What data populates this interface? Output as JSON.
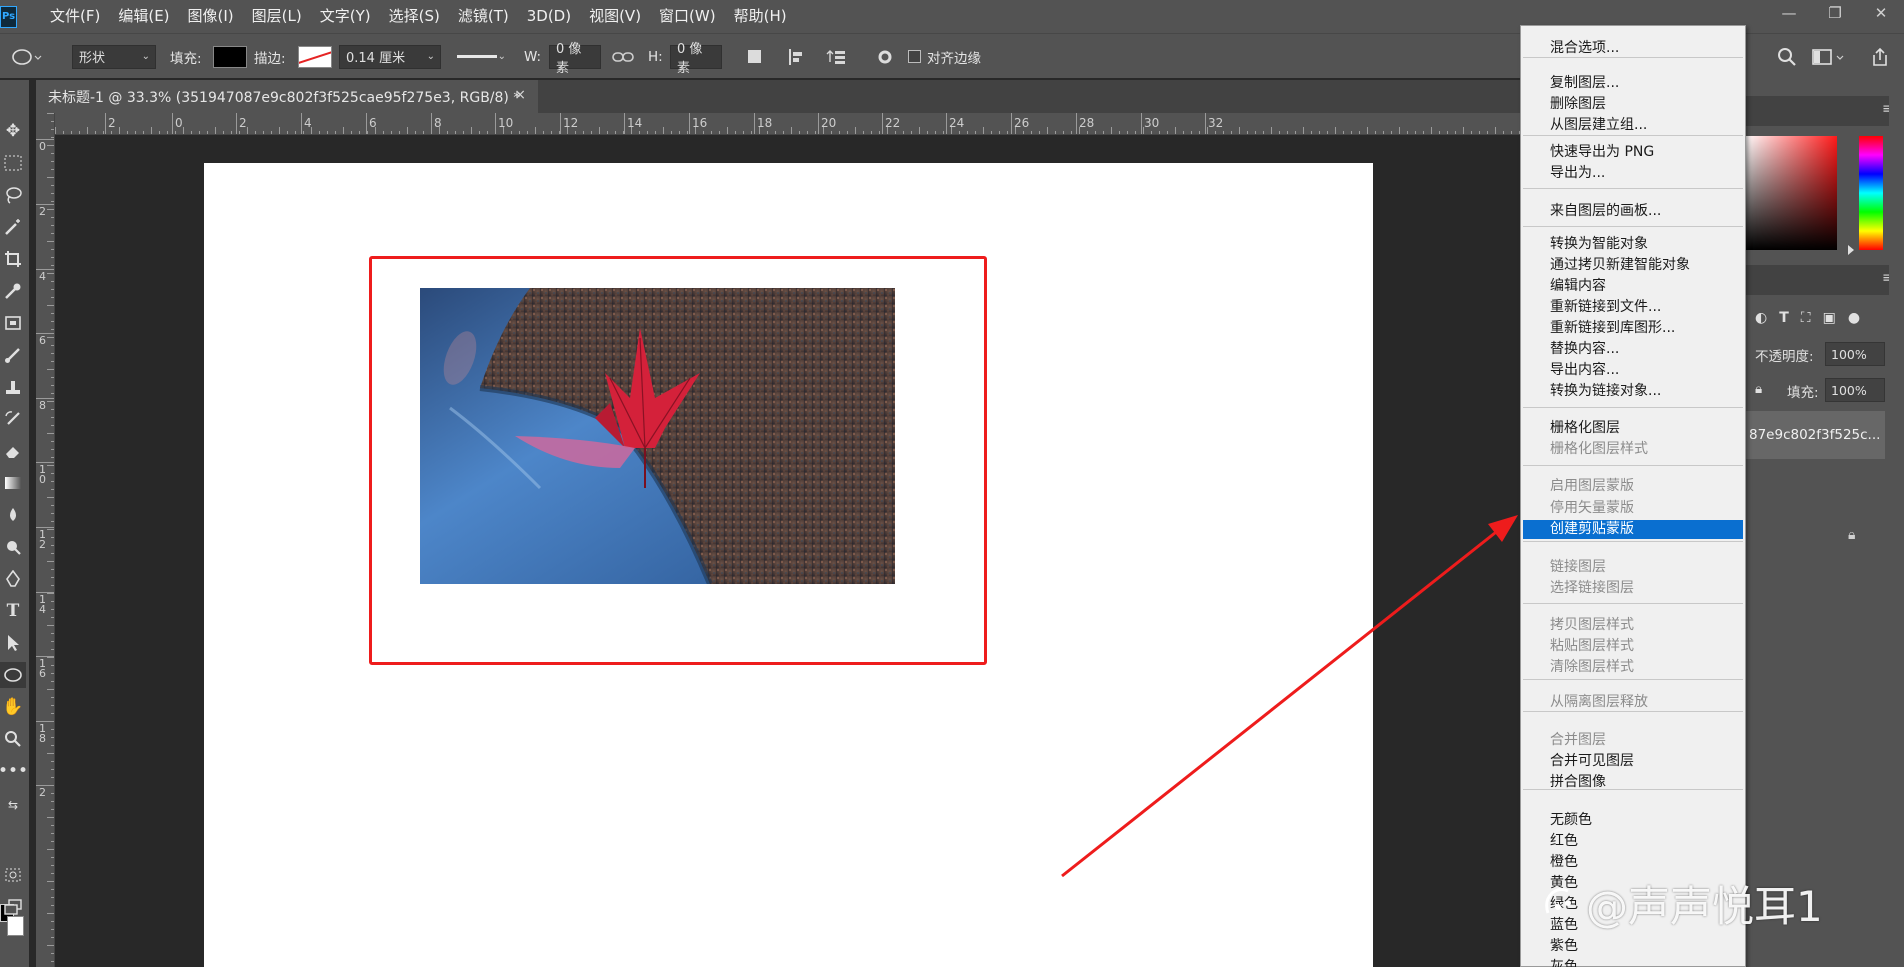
{
  "app": {
    "logo": "Ps",
    "menus": [
      "文件(F)",
      "编辑(E)",
      "图像(I)",
      "图层(L)",
      "文字(Y)",
      "选择(S)",
      "滤镜(T)",
      "3D(D)",
      "视图(V)",
      "窗口(W)",
      "帮助(H)"
    ],
    "window_controls": {
      "minimize": "—",
      "restore": "❐",
      "close": "✕"
    }
  },
  "options_bar": {
    "shape_mode": "形状",
    "fill_label": "填充:",
    "stroke_label": "描边:",
    "stroke_width": "0.14 厘米",
    "width_label": "W:",
    "width_value": "0 像素",
    "height_label": "H:",
    "height_value": "0 像素",
    "align_edges_label": "对齐边缘"
  },
  "document_tab": {
    "title": "未标题-1 @ 33.3% (351947087e9c802f3f525cae95f275e3, RGB/8) *",
    "close": "×"
  },
  "rulers": {
    "top_labels": [
      "2",
      "0",
      "2",
      "4",
      "6",
      "8",
      "10",
      "12",
      "14",
      "16",
      "18",
      "20",
      "22",
      "24",
      "26",
      "28",
      "30",
      "32"
    ],
    "left_labels": [
      "0",
      "2",
      "4",
      "6",
      "8",
      "1\n0",
      "1\n2",
      "1\n4",
      "1\n6",
      "1\n8",
      "2"
    ]
  },
  "layers_panel": {
    "opacity_label": "不透明度:",
    "opacity_value": "100%",
    "fill_label": "填充:",
    "fill_value": "100%",
    "layer_name": "87e9c802f3f525c..."
  },
  "context_menu": {
    "items": [
      {
        "label": "混合选项...",
        "disabled": false
      },
      {
        "label": "复制图层...",
        "disabled": false
      },
      {
        "label": "删除图层",
        "disabled": false
      },
      {
        "label": "从图层建立组...",
        "disabled": false
      },
      {
        "label": "快速导出为 PNG",
        "disabled": false
      },
      {
        "label": "导出为...",
        "disabled": false
      },
      {
        "label": "来自图层的画板...",
        "disabled": false
      },
      {
        "label": "转换为智能对象",
        "disabled": false
      },
      {
        "label": "通过拷贝新建智能对象",
        "disabled": false
      },
      {
        "label": "编辑内容",
        "disabled": false
      },
      {
        "label": "重新链接到文件...",
        "disabled": false
      },
      {
        "label": "重新链接到库图形...",
        "disabled": false
      },
      {
        "label": "替换内容...",
        "disabled": false
      },
      {
        "label": "导出内容...",
        "disabled": false
      },
      {
        "label": "转换为链接对象...",
        "disabled": false
      },
      {
        "label": "栅格化图层",
        "disabled": false
      },
      {
        "label": "栅格化图层样式",
        "disabled": true
      },
      {
        "label": "启用图层蒙版",
        "disabled": true
      },
      {
        "label": "停用矢量蒙版",
        "disabled": true
      },
      {
        "label": "创建剪贴蒙版",
        "disabled": false,
        "selected": true
      },
      {
        "label": "链接图层",
        "disabled": true
      },
      {
        "label": "选择链接图层",
        "disabled": true
      },
      {
        "label": "拷贝图层样式",
        "disabled": true
      },
      {
        "label": "粘贴图层样式",
        "disabled": true
      },
      {
        "label": "清除图层样式",
        "disabled": true
      },
      {
        "label": "从隔离图层释放",
        "disabled": true
      },
      {
        "label": "合并图层",
        "disabled": true
      },
      {
        "label": "合并可见图层",
        "disabled": false
      },
      {
        "label": "拼合图像",
        "disabled": false
      },
      {
        "label": "无颜色",
        "disabled": false
      },
      {
        "label": "红色",
        "disabled": false
      },
      {
        "label": "橙色",
        "disabled": false
      },
      {
        "label": "黄色",
        "disabled": false
      },
      {
        "label": "绿色",
        "disabled": false
      },
      {
        "label": "蓝色",
        "disabled": false
      },
      {
        "label": "紫色",
        "disabled": false
      },
      {
        "label": "灰色",
        "disabled": false
      }
    ]
  },
  "watermark": {
    "text": "@声声悦耳1"
  },
  "colors": {
    "accent_selected": "#0a6fd0",
    "annotation_red": "#ee1c1c",
    "panel_bg": "#535353",
    "canvas_bg": "#282828"
  }
}
